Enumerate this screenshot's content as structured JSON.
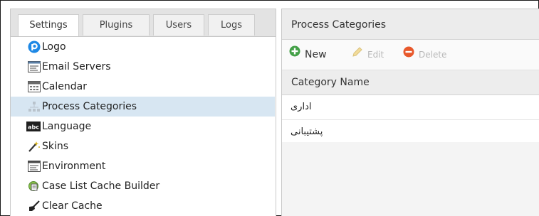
{
  "tabs": [
    {
      "label": "Settings",
      "active": true
    },
    {
      "label": "Plugins",
      "active": false
    },
    {
      "label": "Users",
      "active": false
    },
    {
      "label": "Logs",
      "active": false
    }
  ],
  "tree": [
    {
      "label": "Logo",
      "icon": "logo-icon"
    },
    {
      "label": "Email Servers",
      "icon": "email-servers-icon"
    },
    {
      "label": "Calendar",
      "icon": "calendar-icon"
    },
    {
      "label": "Process Categories",
      "icon": "process-categories-icon",
      "selected": true
    },
    {
      "label": "Language",
      "icon": "language-icon"
    },
    {
      "label": "Skins",
      "icon": "skins-icon"
    },
    {
      "label": "Environment",
      "icon": "environment-icon"
    },
    {
      "label": "Case List Cache Builder",
      "icon": "case-list-cache-builder-icon"
    },
    {
      "label": "Clear Cache",
      "icon": "clear-cache-icon"
    }
  ],
  "panel": {
    "title": "Process Categories",
    "toolbar": {
      "new_label": "New",
      "edit_label": "Edit",
      "delete_label": "Delete"
    },
    "grid": {
      "column_header": "Category Name",
      "rows": [
        "اداری",
        "پشتیبانی"
      ]
    }
  },
  "colors": {
    "selection": "#d7e6f2",
    "new_green": "#43a047",
    "delete_orange": "#e8582b",
    "edit_disabled": "#b8b8b8"
  }
}
